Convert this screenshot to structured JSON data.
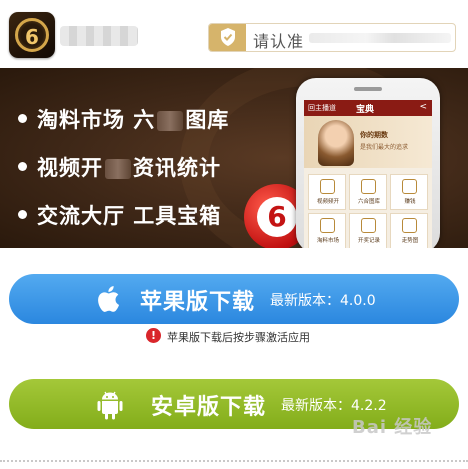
{
  "header": {
    "logo_text": "6",
    "verify_label": "请认准"
  },
  "banner": {
    "features": [
      {
        "pre": "淘料市场 六",
        "post": "图库"
      },
      {
        "pre": "视频开",
        "post": "资讯统计"
      },
      {
        "pre": "交流大厅 工具宝箱",
        "post": ""
      }
    ],
    "ball_number": "6",
    "phone": {
      "bar_left": "回主播道",
      "bar_center": "宝典",
      "ad_line1": "你的期数",
      "ad_line2": "是我们最大的追求",
      "grid_items": [
        "视频频开",
        "六合图库",
        "赚钱",
        "淘料市场",
        "开奖记录",
        "走势图"
      ]
    }
  },
  "downloads": {
    "ios": {
      "label": "苹果版下载",
      "version": "最新版本：4.0.0"
    },
    "notice": "苹果版下载后按步骤激活应用",
    "android": {
      "label": "安卓版下载",
      "version": "最新版本：4.2.2"
    }
  },
  "watermark": "Bai 经验",
  "colors": {
    "ios_button": "#3d9ae8",
    "android_button": "#93bb27",
    "banner_bg": "#3e2717",
    "notice_icon": "#d9262b",
    "accent_gold": "#d6b46b"
  },
  "icons": {
    "verify": "shield-check-icon",
    "ios": "apple-icon",
    "android": "android-icon",
    "notice": "alert-icon"
  }
}
